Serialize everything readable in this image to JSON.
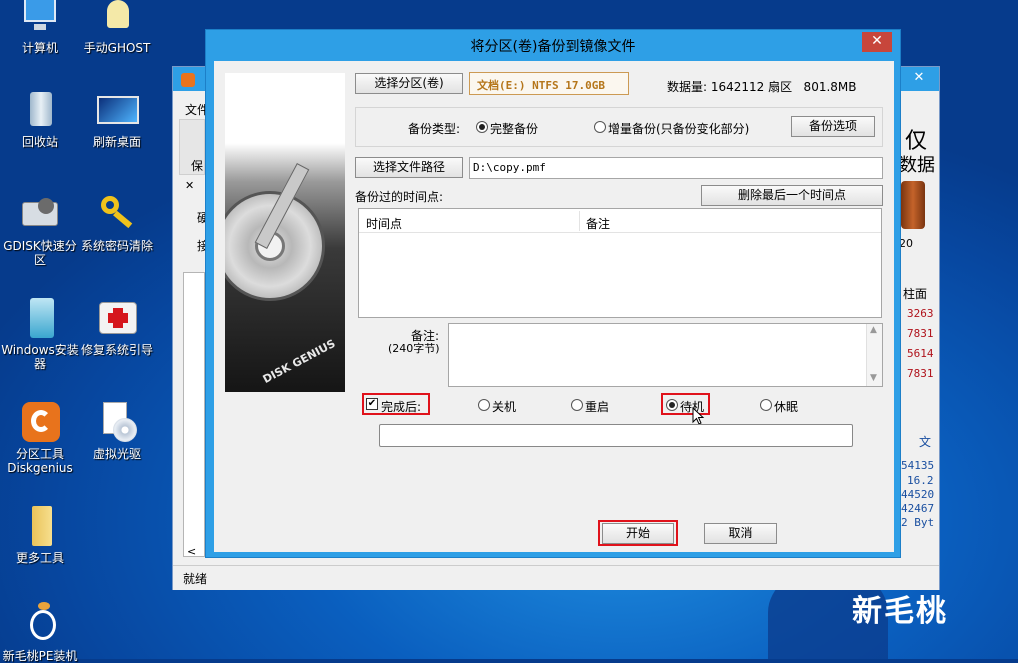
{
  "desktop": {
    "icons": [
      {
        "label": "计算机",
        "icon": "computer-icon"
      },
      {
        "label": "手动GHOST",
        "icon": "ghost-icon"
      },
      {
        "label": "回收站",
        "icon": "recycle-bin-icon"
      },
      {
        "label": "刷新桌面",
        "icon": "refresh-desktop-icon"
      },
      {
        "label": "GDISK快速分区",
        "icon": "gdisk-icon"
      },
      {
        "label": "系统密码清除",
        "icon": "key-icon"
      },
      {
        "label": "Windows安装器",
        "icon": "windows-installer-icon"
      },
      {
        "label": "修复系统引导",
        "icon": "repair-kit-icon"
      },
      {
        "label": "分区工具Diskgenius",
        "icon": "diskgenius-icon"
      },
      {
        "label": "虚拟光驱",
        "icon": "virtual-drive-icon"
      },
      {
        "label": "更多工具",
        "icon": "folder-icon"
      },
      {
        "label": "新毛桃PE装机",
        "icon": "peach-icon"
      }
    ],
    "watermark": "新毛桃"
  },
  "bgwindow": {
    "menu_file": "文件",
    "save_fragment": "保",
    "side_a": "硬",
    "side_b": "接",
    "right_big1": "仅",
    "right_big2": "数据",
    "right_20": "20",
    "cyl_header": "柱面",
    "cyl_values": [
      "3263",
      "7831",
      "5614",
      "7831"
    ],
    "right_wen": "文",
    "right_nums": [
      "54135",
      "16.2",
      "44520",
      "42467",
      "2 Byt"
    ],
    "right_3": "3",
    "status": "就绪",
    "close_glyph": "✕"
  },
  "dialog": {
    "title": "将分区(卷)备份到镜像文件",
    "close_glyph": "✕",
    "select_partition_btn": "选择分区(卷)",
    "partition_info": "文档(E:) NTFS 17.0GB",
    "data_amount": "数据量: 1642112 扇区   801.8MB",
    "backup_type_label": "备份类型:",
    "full_backup": "完整备份",
    "incremental_backup": "增量备份(只备份变化部分)",
    "backup_options_btn": "备份选项",
    "select_path_btn": "选择文件路径",
    "file_path": "D:\\copy.pmf",
    "timepoints_label": "备份过的时间点:",
    "delete_last_btn": "删除最后一个时间点",
    "col_time": "时间点",
    "col_note": "备注",
    "note_label": "备注:",
    "note_limit": "(240字节)",
    "after_done_label": "完成后:",
    "after_done_checked": true,
    "opt_shutdown": "关机",
    "opt_restart": "重启",
    "opt_standby": "待机",
    "opt_hibernate": "休眠",
    "selected_after": "待机",
    "start_btn": "开始",
    "cancel_btn": "取消",
    "image_text": "DISK GENIUS"
  },
  "colors": {
    "accent": "#2e9fe6",
    "highlight": "#e0121b",
    "close": "#c7463b",
    "cyl_value": "#b0121b",
    "link_blue": "#1a4fa0"
  }
}
